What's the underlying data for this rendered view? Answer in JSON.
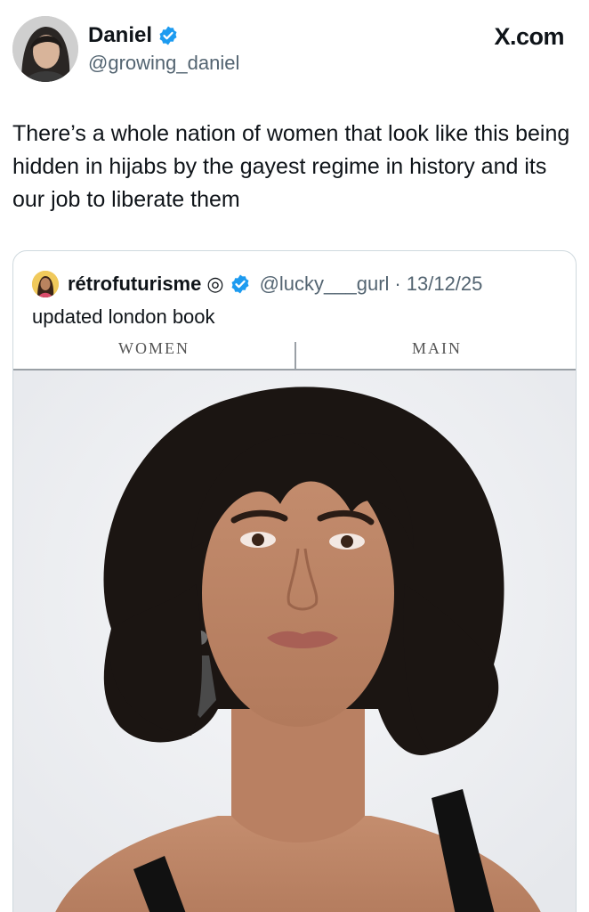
{
  "author": {
    "display_name": "Daniel",
    "handle": "@growing_daniel",
    "verified": true,
    "avatar_icon": "profile-photo"
  },
  "brand": "X.com",
  "tweet": {
    "text": "There’s a whole nation of women that look like this being hidden in hijabs by the gayest regime in history and its our job to liberate them"
  },
  "quote": {
    "display_name": "rétrofuturisme",
    "name_emoji": "◎",
    "verified": true,
    "handle": "@lucky___gurl",
    "separator": "·",
    "date": "13/12/25",
    "text": "updated london book",
    "media": {
      "nav_left": "WOMEN",
      "nav_right": "MAIN",
      "image_icon": "portrait-photo"
    }
  },
  "colors": {
    "verified_blue": "#1d9bf0",
    "text_primary": "#0f1419",
    "text_secondary": "#536471",
    "border": "#cfd9de"
  }
}
